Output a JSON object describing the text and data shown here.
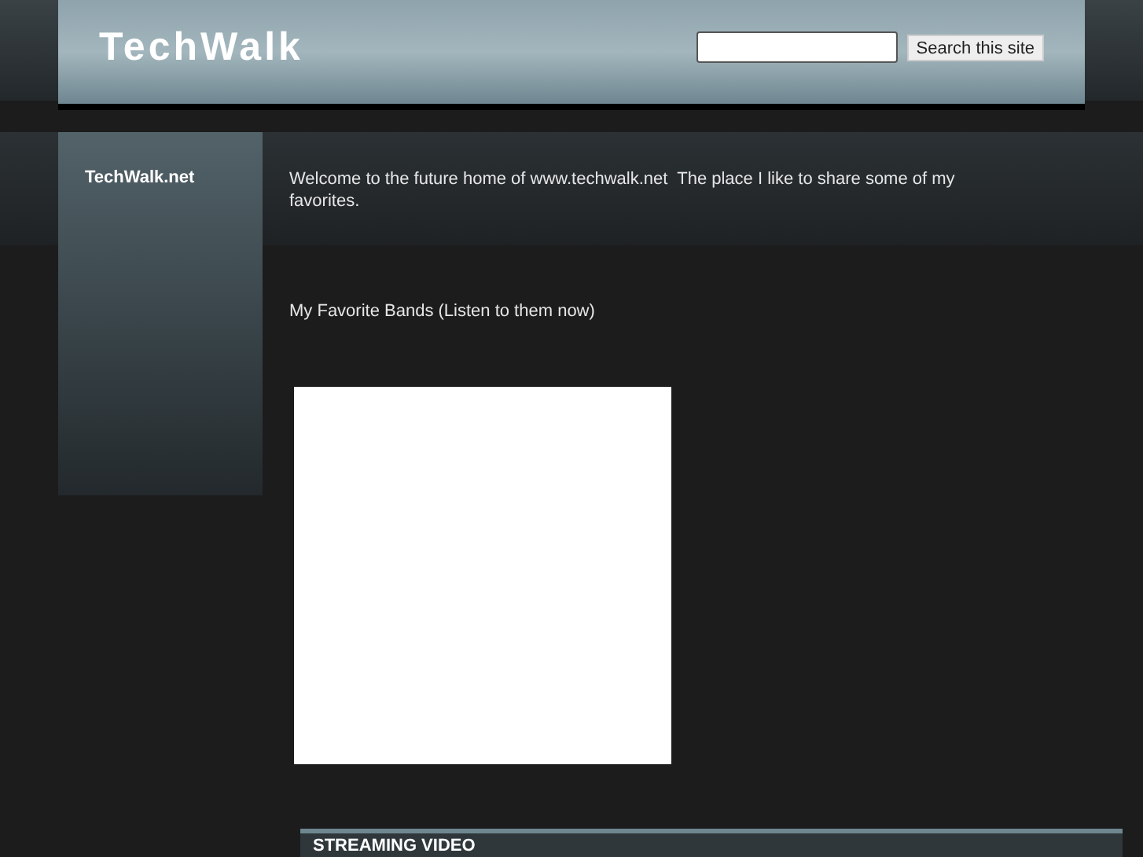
{
  "header": {
    "title": "TechWalk",
    "search_button": "Search this site"
  },
  "sidebar": {
    "title": "TechWalk.net"
  },
  "intro": "Welcome to the future home of www.techwalk.net  The place I like to share some of my favorites.",
  "bands_heading": "My Favorite Bands (Listen to them now)",
  "embed": {
    "kind": "blank"
  },
  "streaming": {
    "title": "STREAMING VIDEO"
  }
}
